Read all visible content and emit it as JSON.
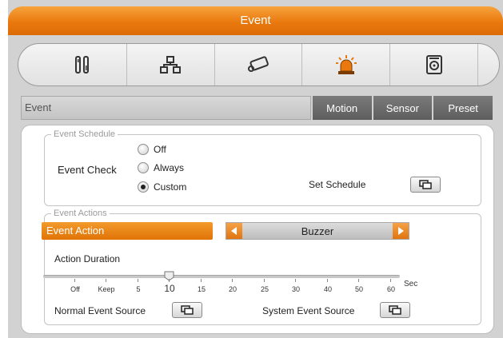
{
  "title": "Event",
  "icons": [
    "tools-icon",
    "network-icon",
    "camera-icon",
    "alarm-siren-icon",
    "storage-disk-icon"
  ],
  "active_icon_index": 3,
  "breadcrumb": "Event",
  "tabs": {
    "motion": "Motion",
    "sensor": "Sensor",
    "preset": "Preset"
  },
  "schedule": {
    "legend": "Event Schedule",
    "check_label": "Event Check",
    "options": [
      "Off",
      "Always",
      "Custom"
    ],
    "selected": "Custom",
    "set_schedule_label": "Set Schedule"
  },
  "actions": {
    "legend": "Event Actions",
    "event_action_label": "Event Action",
    "selected_action": "Buzzer",
    "duration_label": "Action Duration",
    "duration_ticks": [
      "Off",
      "Keep",
      "5",
      "10",
      "15",
      "20",
      "25",
      "30",
      "40",
      "50",
      "60"
    ],
    "duration_value": "10",
    "unit": "Sec",
    "normal_source_label": "Normal Event Source",
    "system_source_label": "System Event Source"
  },
  "colors": {
    "accent": "#e9790e",
    "tab_bg": "#6a6a6a",
    "frame_bg": "#d2d2d2"
  }
}
